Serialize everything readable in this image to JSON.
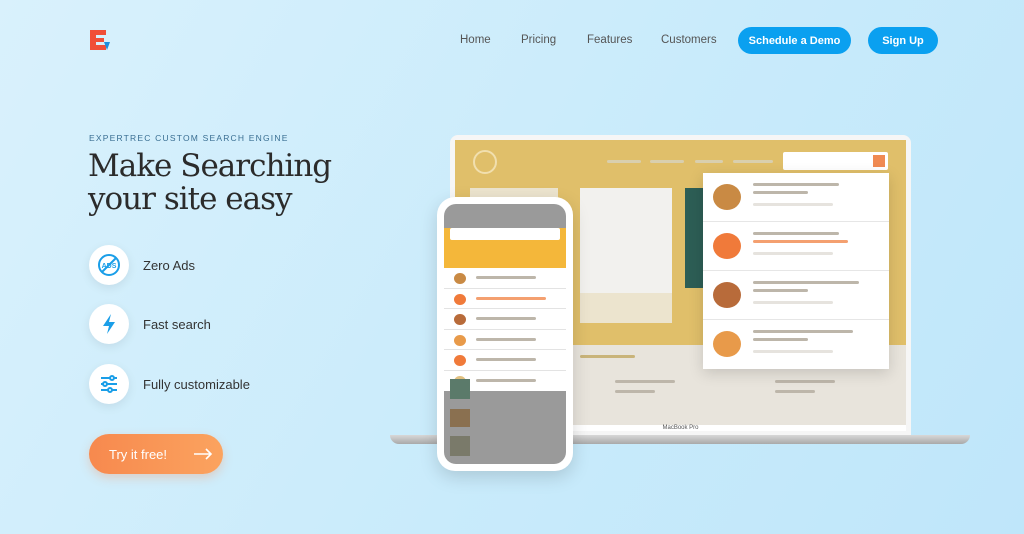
{
  "nav": {
    "items": [
      "Home",
      "Pricing",
      "Features",
      "Customers"
    ],
    "demo": "Schedule a Demo",
    "signup": "Sign Up"
  },
  "hero": {
    "eyebrow": "EXPERTREC CUSTOM SEARCH ENGINE",
    "title_line1": "Make Searching",
    "title_line2": "your site easy",
    "cta": "Try it free!"
  },
  "features": [
    {
      "icon": "no-ads-icon",
      "label": "Zero Ads"
    },
    {
      "icon": "lightning-icon",
      "label": "Fast search"
    },
    {
      "icon": "sliders-icon",
      "label": "Fully customizable"
    }
  ],
  "mockup": {
    "laptop_label": "MacBook Pro"
  },
  "colors": {
    "accent": "#0aa0f0",
    "cta": "#f7894e",
    "logo": "#f04e37"
  }
}
